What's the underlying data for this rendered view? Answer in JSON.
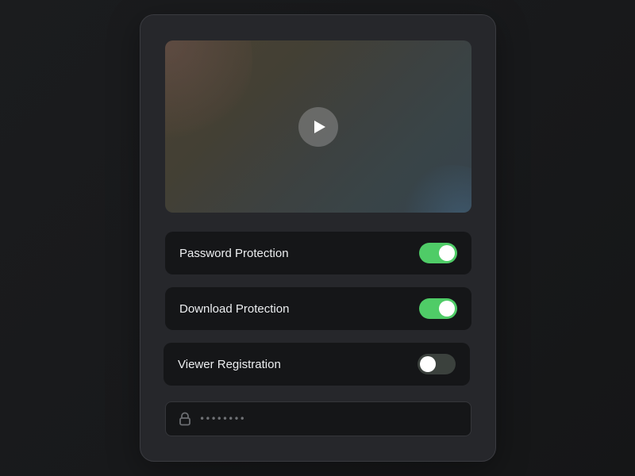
{
  "video": {
    "play_icon": "play-icon"
  },
  "settings": [
    {
      "label": "Password Protection",
      "enabled": true
    },
    {
      "label": "Download Protection",
      "enabled": true
    },
    {
      "label": "Viewer Registration",
      "enabled": false
    }
  ],
  "password_field": {
    "icon": "lock-icon",
    "value": "••••••••"
  },
  "colors": {
    "toggle_on": "#4fcc67",
    "toggle_off": "#3b413d",
    "card_bg": "#26272b",
    "row_bg": "#151618"
  }
}
